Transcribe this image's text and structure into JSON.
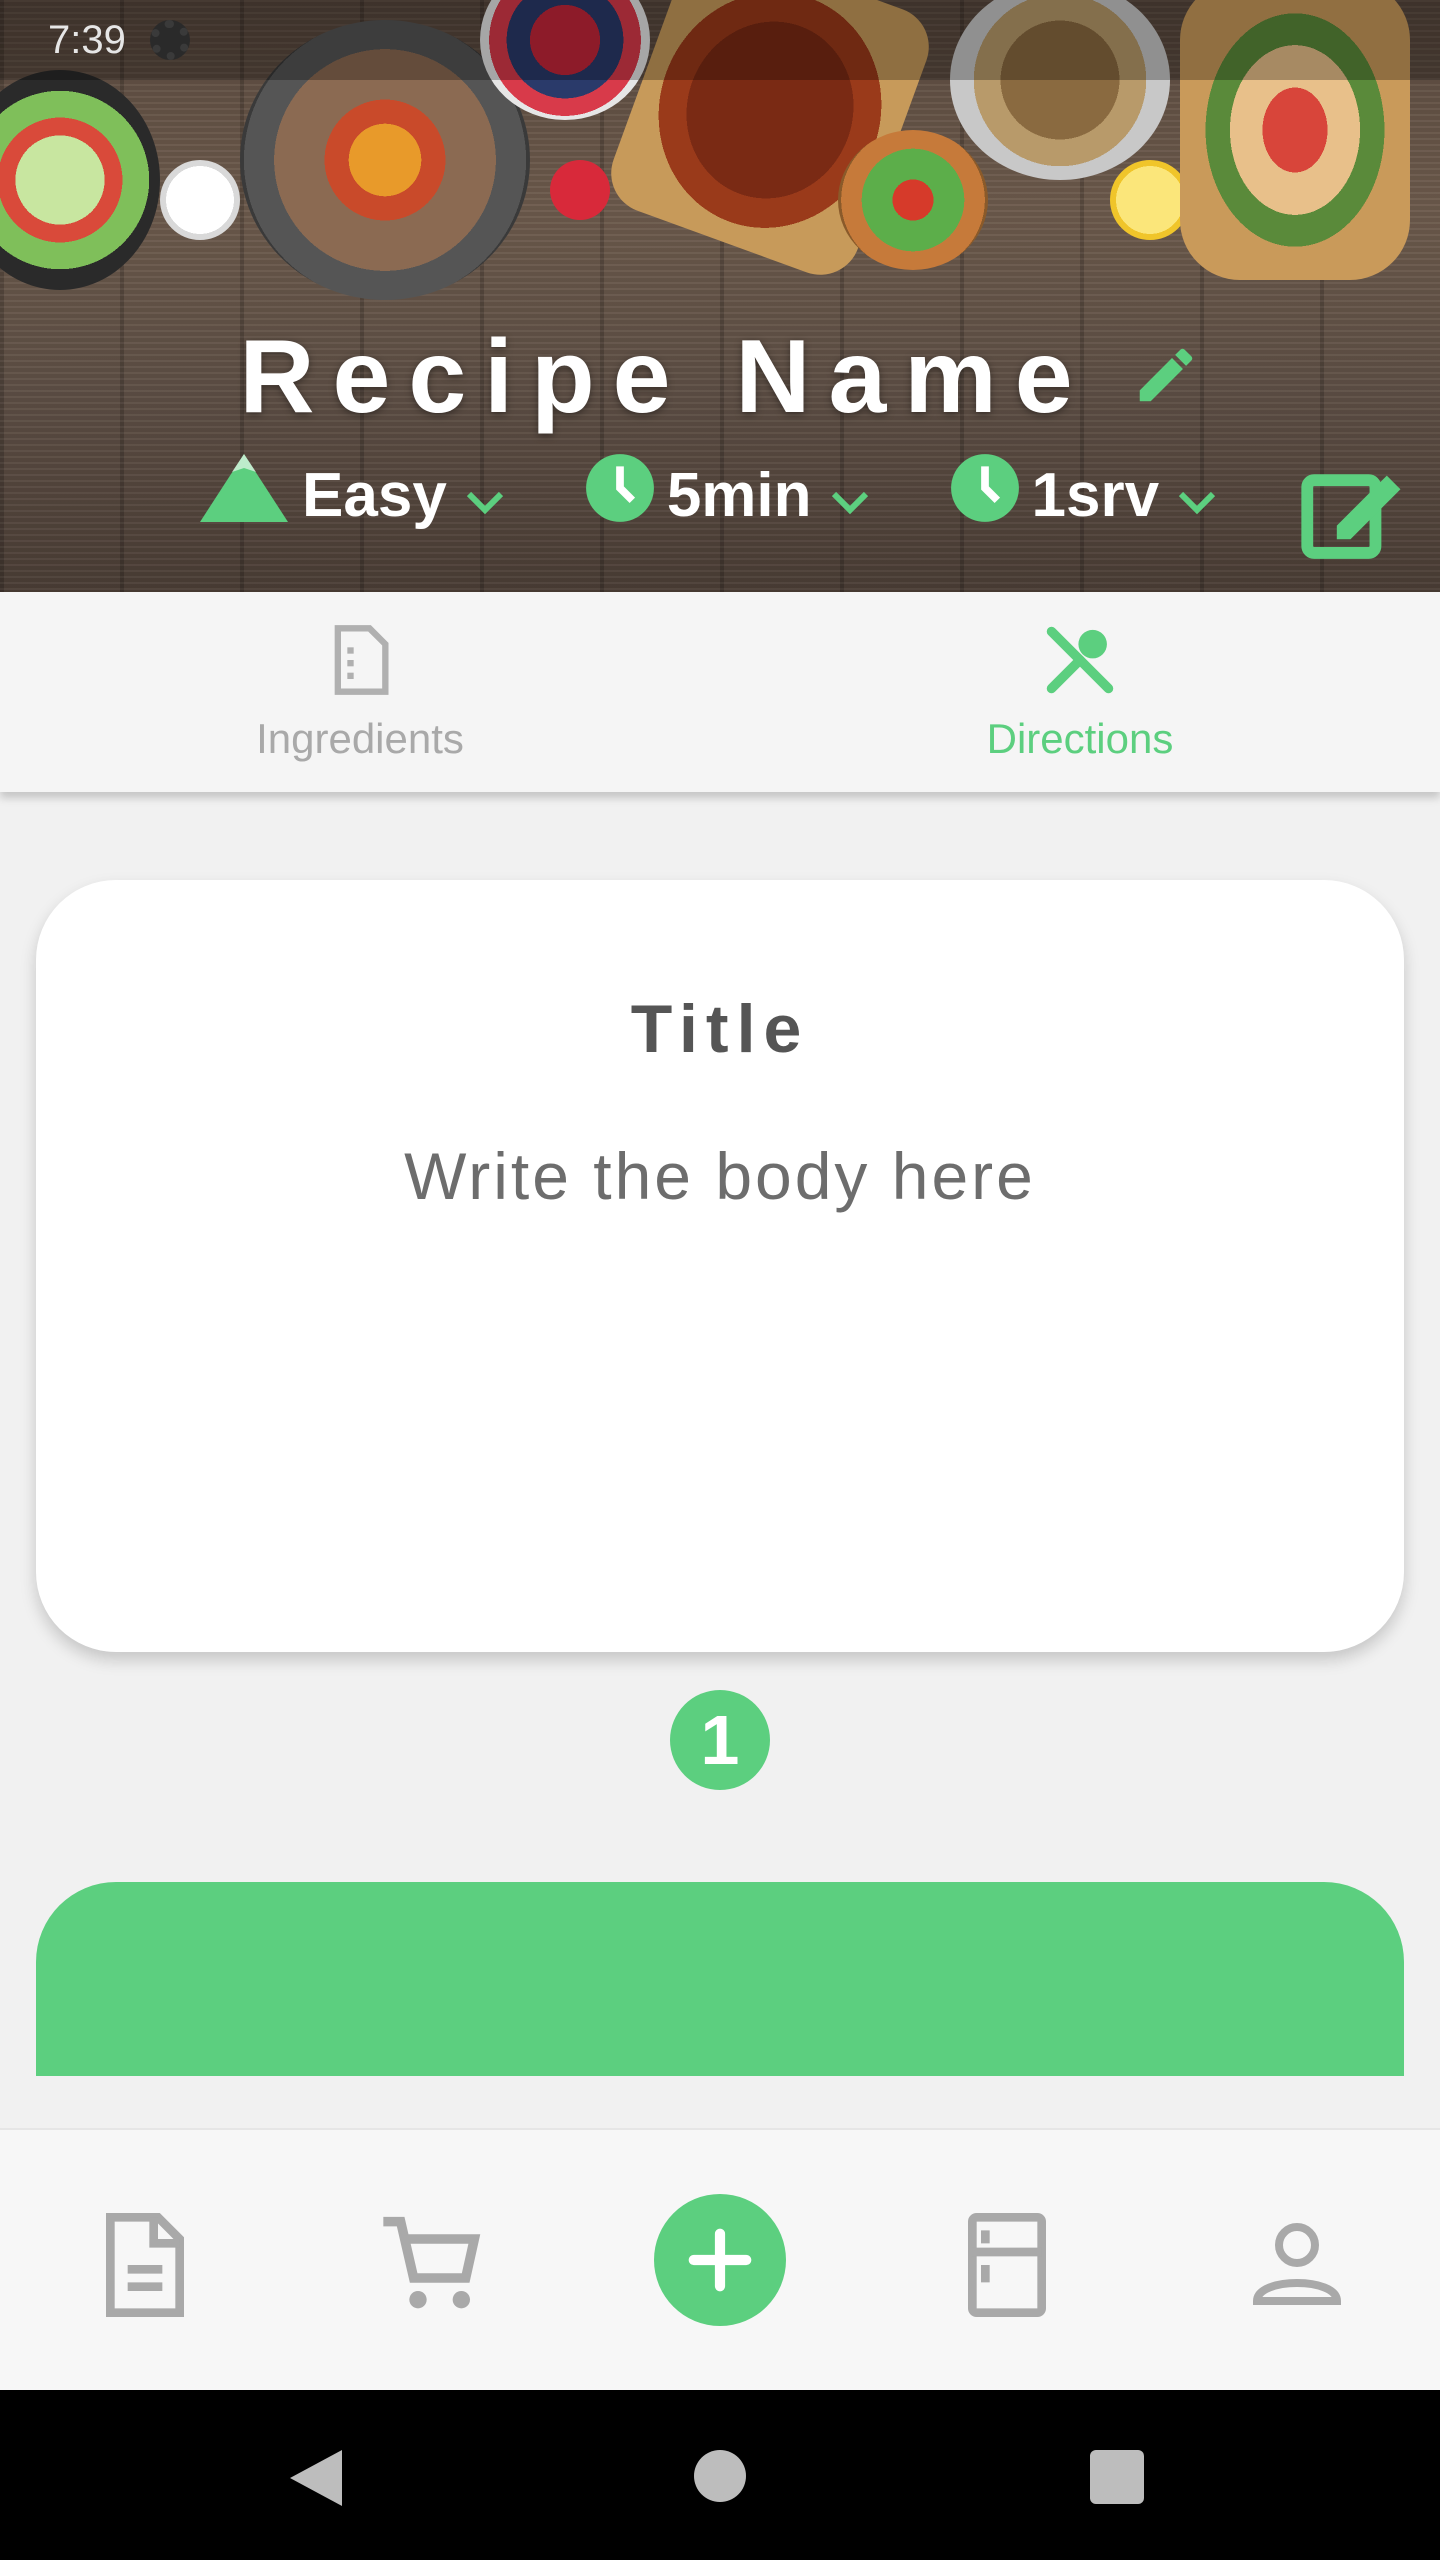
{
  "status_bar": {
    "time": "7:39"
  },
  "header": {
    "recipe_name": "Recipe Name",
    "difficulty": {
      "value": "Easy",
      "icon": "mountain-icon"
    },
    "time": {
      "value": "5min",
      "icon": "clock-icon"
    },
    "servings": {
      "value": "1srv",
      "icon": "clock-icon"
    },
    "accent_color": "#5ccf7f"
  },
  "tabs": [
    {
      "label": "Ingredients",
      "icon": "document-icon",
      "active": false
    },
    {
      "label": "Directions",
      "icon": "utensils-icon",
      "active": true
    }
  ],
  "direction_card": {
    "title": "Title",
    "body_placeholder": "Write the body here",
    "step_number": "1"
  },
  "bottom_nav": [
    {
      "icon": "recipes-icon"
    },
    {
      "icon": "cart-icon"
    },
    {
      "icon": "add-icon"
    },
    {
      "icon": "fridge-icon"
    },
    {
      "icon": "profile-icon"
    }
  ]
}
